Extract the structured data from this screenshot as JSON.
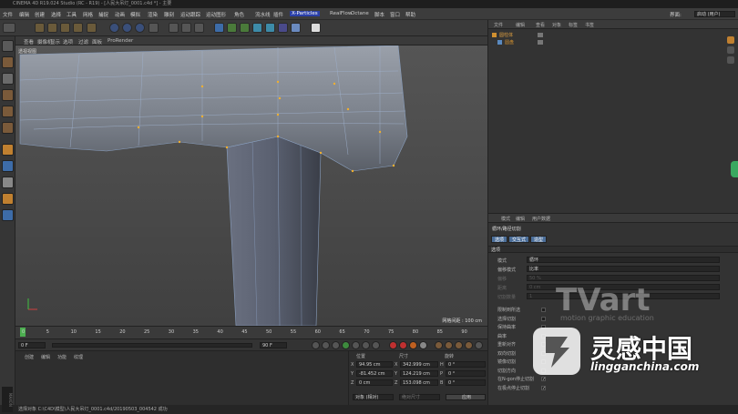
{
  "app": {
    "title": "CINEMA 4D R19.024 Studio (RC - R19) - [人民大吊灯_0001.c4d *] - 主要"
  },
  "menu": {
    "items": [
      "文件",
      "编辑",
      "创建",
      "选择",
      "工具",
      "网格",
      "捕捉",
      "动画",
      "模拟",
      "渲染",
      "雕刻",
      "运动跟踪",
      "运动图形",
      "角色",
      "流水线",
      "插件",
      "X-Particles",
      "RealFlow",
      "Octane",
      "脚本",
      "窗口",
      "帮助"
    ],
    "layout_label": "界面:",
    "layout_value": "启动 (用户)"
  },
  "viewport": {
    "menu": [
      "查看",
      "摄像机",
      "显示",
      "选项",
      "过滤",
      "面板",
      "ProRender"
    ],
    "name": "透视视图",
    "grid_label": "网格间距 : 100 cm"
  },
  "timeline": {
    "ticks": [
      "0",
      "5",
      "10",
      "15",
      "20",
      "25",
      "30",
      "35",
      "40",
      "45",
      "50",
      "55",
      "60",
      "65",
      "70",
      "75",
      "80",
      "85",
      "90"
    ],
    "current": "0 F",
    "start_field": "0 F",
    "end_field": "90 F",
    "end_field2": "90 F"
  },
  "material_panel": {
    "menu": [
      "创建",
      "编辑",
      "功能",
      "纹理"
    ]
  },
  "coordinates": {
    "headers": [
      "位置",
      "尺寸",
      "旋转"
    ],
    "rows": [
      {
        "axis": "X",
        "pos": "94.95 cm",
        "size_axis": "X",
        "size": "342.999 cm",
        "rot_axis": "H",
        "rot": "0 °"
      },
      {
        "axis": "Y",
        "pos": "-81.452 cm",
        "size_axis": "Y",
        "size": "124.219 cm",
        "rot_axis": "P",
        "rot": "0 °"
      },
      {
        "axis": "Z",
        "pos": "0 cm",
        "size_axis": "Z",
        "size": "153.098 cm",
        "rot_axis": "B",
        "rot": "0 °"
      }
    ],
    "mode": "对象 (相对)",
    "size_mode": "绝对尺寸",
    "apply": "应用"
  },
  "object_manager": {
    "menu": [
      "文件",
      "编辑",
      "查看",
      "对象",
      "标签",
      "书签"
    ],
    "objects": [
      "圆柱体",
      "圆盘"
    ]
  },
  "attributes": {
    "menu": [
      "模式",
      "编辑",
      "用户数据"
    ],
    "tool_name": "循环/路径切割",
    "tabs": [
      "选项",
      "交互式",
      "造型"
    ],
    "section": "选项",
    "fields": [
      {
        "label": "模式",
        "value": "循环",
        "dim": false
      },
      {
        "label": "偏移模式",
        "value": "比率",
        "dim": false
      },
      {
        "label": "偏移",
        "value": "50 %",
        "dim": true
      },
      {
        "label": "距离",
        "value": "0 cm",
        "dim": true
      },
      {
        "label": "切割数量",
        "value": "1",
        "dim": true
      }
    ],
    "checks": [
      {
        "label": "限制到所选",
        "checked": false
      },
      {
        "label": "选择切割",
        "checked": false
      },
      {
        "label": "保持曲率",
        "checked": false
      },
      {
        "label": "曲率",
        "checked": false
      },
      {
        "label": "重新对齐",
        "checked": false
      },
      {
        "label": "双向切割",
        "checked": false
      },
      {
        "label": "镜像切割",
        "checked": false
      },
      {
        "label": "切割方向",
        "checked": false
      },
      {
        "label": "在N-gon停止切割",
        "checked": true
      },
      {
        "label": "在极点停止切割",
        "checked": true
      }
    ]
  },
  "status": "选择对象 C:\\C4D\\模型\\人民大吊灯_0001.c4d/20190503_004542 成功",
  "watermark": {
    "brand": "TVart",
    "tagline": "motion graphic education",
    "cn": "灵感中国",
    "url": "lingganchina.com"
  },
  "colors": {
    "accent": "#4b6e99",
    "viewport_bg": "#4a4a4a",
    "mesh": "#8f96a3"
  }
}
